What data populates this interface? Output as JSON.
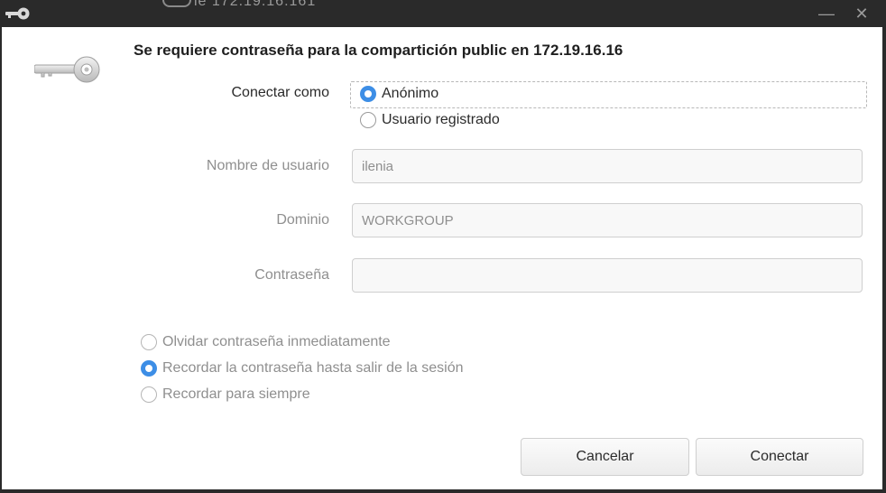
{
  "window": {
    "behind_title": "le  172.19.16.161",
    "minimize_glyph": "—",
    "close_glyph": "✕",
    "icon": "key-icon"
  },
  "dialog": {
    "heading": "Se requiere contraseña para la compartición public en 172.19.16.16",
    "connect_as_label": "Conectar como",
    "connect_as_options": [
      {
        "label": "Anónimo",
        "checked": true
      },
      {
        "label": "Usuario registrado",
        "checked": false
      }
    ],
    "username_label": "Nombre de usuario",
    "username_value": "ilenia",
    "domain_label": "Dominio",
    "domain_value": "WORKGROUP",
    "password_label": "Contraseña",
    "password_value": "",
    "remember_options": [
      {
        "label": "Olvidar contraseña inmediatamente",
        "checked": false
      },
      {
        "label": "Recordar la contraseña hasta salir de la sesión",
        "checked": true
      },
      {
        "label": "Recordar para siempre",
        "checked": false
      }
    ],
    "cancel_label": "Cancelar",
    "connect_label": "Conectar"
  },
  "colors": {
    "accent": "#3d8ee6",
    "titlebar": "#2a2a2a",
    "disabled_text": "#8f8f8f"
  }
}
